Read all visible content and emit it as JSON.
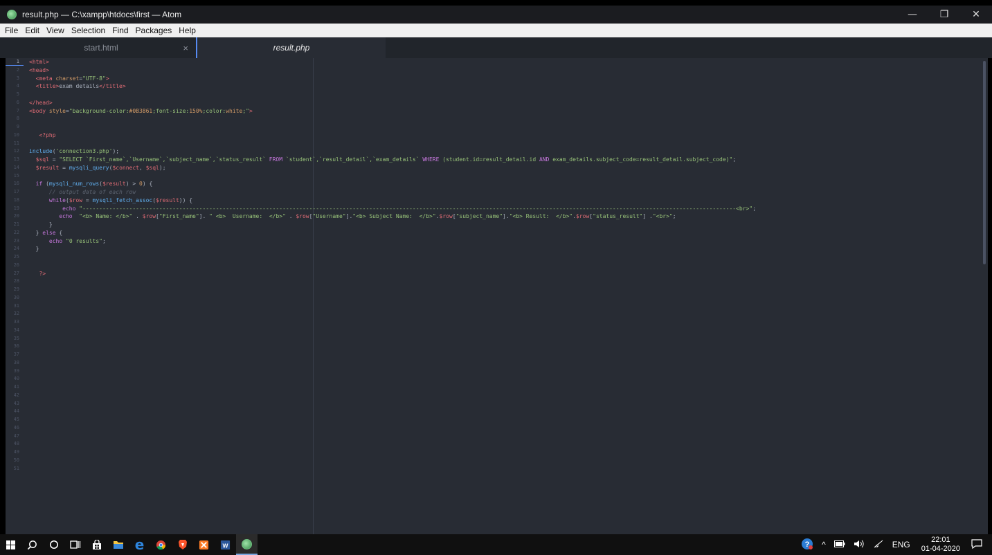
{
  "window": {
    "title": "result.php — C:\\xampp\\htdocs\\first — Atom",
    "controls": [
      "—",
      "❐",
      "✕"
    ]
  },
  "menu": [
    "File",
    "Edit",
    "View",
    "Selection",
    "Find",
    "Packages",
    "Help"
  ],
  "tabs": [
    {
      "label": "start.html",
      "active": false,
      "close": "×"
    },
    {
      "label": "result.php",
      "active": true
    }
  ],
  "editor": {
    "line_count": 51,
    "current_line": 1,
    "lines": [
      [
        [
          "t-tag",
          "<html>"
        ]
      ],
      [
        [
          "t-tag",
          "<head>"
        ]
      ],
      [
        [
          "t-def",
          "  "
        ],
        [
          "t-tag",
          "<meta "
        ],
        [
          "t-attr",
          "charset"
        ],
        [
          "t-def",
          "="
        ],
        [
          "t-str",
          "\"UTF-8\""
        ],
        [
          "t-tag",
          ">"
        ]
      ],
      [
        [
          "t-def",
          "  "
        ],
        [
          "t-tag",
          "<title>"
        ],
        [
          "t-def",
          "exam details"
        ],
        [
          "t-tag",
          "</title>"
        ]
      ],
      [],
      [
        [
          "t-tag",
          "</head>"
        ]
      ],
      [
        [
          "t-tag",
          "<body "
        ],
        [
          "t-attr",
          "style"
        ],
        [
          "t-def",
          "="
        ],
        [
          "t-str",
          "\"background-color:"
        ],
        [
          "t-num",
          "#0B3861"
        ],
        [
          "t-str",
          ";font-size:"
        ],
        [
          "t-num",
          "150%"
        ],
        [
          "t-str",
          ";color:"
        ],
        [
          "t-attr",
          "white"
        ],
        [
          "t-str",
          ";\""
        ],
        [
          "t-tag",
          ">"
        ]
      ],
      [],
      [],
      [
        [
          "t-def",
          "   "
        ],
        [
          "t-tag",
          "<?php"
        ]
      ],
      [],
      [
        [
          "t-fn",
          "include"
        ],
        [
          "t-def",
          "("
        ],
        [
          "t-str",
          "'connection3.php'"
        ],
        [
          "t-def",
          ");"
        ]
      ],
      [
        [
          "t-def",
          "  "
        ],
        [
          "t-var",
          "$sql"
        ],
        [
          "t-def",
          " = "
        ],
        [
          "t-str",
          "\"SELECT `First_name`,`Username`,`subject_name`,`status_result` "
        ],
        [
          "t-kw",
          "FROM"
        ],
        [
          "t-str",
          " `student`,`result_detail`,`exam_details` "
        ],
        [
          "t-kw",
          "WHERE"
        ],
        [
          "t-str",
          " (student.id=result_detail.id "
        ],
        [
          "t-kw",
          "AND"
        ],
        [
          "t-str",
          " exam_details.subject_code=result_detail.subject_code)\""
        ],
        [
          "t-def",
          ";"
        ]
      ],
      [
        [
          "t-def",
          "  "
        ],
        [
          "t-var",
          "$result"
        ],
        [
          "t-def",
          " = "
        ],
        [
          "t-fn",
          "mysqli_query"
        ],
        [
          "t-def",
          "("
        ],
        [
          "t-var",
          "$connect"
        ],
        [
          "t-def",
          ", "
        ],
        [
          "t-var",
          "$sql"
        ],
        [
          "t-def",
          ");"
        ]
      ],
      [],
      [
        [
          "t-def",
          "  "
        ],
        [
          "t-kw",
          "if"
        ],
        [
          "t-def",
          " ("
        ],
        [
          "t-fn",
          "mysqli_num_rows"
        ],
        [
          "t-def",
          "("
        ],
        [
          "t-var",
          "$result"
        ],
        [
          "t-def",
          ") > "
        ],
        [
          "t-num",
          "0"
        ],
        [
          "t-def",
          ") {"
        ]
      ],
      [
        [
          "t-def",
          "      "
        ],
        [
          "t-com",
          "// output data of each row"
        ]
      ],
      [
        [
          "t-def",
          "      "
        ],
        [
          "t-kw",
          "while"
        ],
        [
          "t-def",
          "("
        ],
        [
          "t-var",
          "$row"
        ],
        [
          "t-def",
          " = "
        ],
        [
          "t-fn",
          "mysqli_fetch_assoc"
        ],
        [
          "t-def",
          "("
        ],
        [
          "t-var",
          "$result"
        ],
        [
          "t-def",
          ")) {"
        ]
      ],
      [
        [
          "t-def",
          "          "
        ],
        [
          "t-kw",
          "echo"
        ],
        [
          "t-def",
          " "
        ],
        [
          "t-str",
          "\"----------------------------------------------------------------------------------------------------------------------------------------------------------------------------------------------------<br>\""
        ],
        [
          "t-def",
          ";"
        ]
      ],
      [
        [
          "t-def",
          "         "
        ],
        [
          "t-kw",
          "echo"
        ],
        [
          "t-def",
          "  "
        ],
        [
          "t-str",
          "\"<b> Name: </b>\""
        ],
        [
          "t-def",
          " . "
        ],
        [
          "t-var",
          "$row"
        ],
        [
          "t-def",
          "["
        ],
        [
          "t-str",
          "\"First_name\""
        ],
        [
          "t-def",
          "]. "
        ],
        [
          "t-str",
          "\" <b>  Username:  </b>\""
        ],
        [
          "t-def",
          " . "
        ],
        [
          "t-var",
          "$row"
        ],
        [
          "t-def",
          "["
        ],
        [
          "t-str",
          "\"Username\""
        ],
        [
          "t-def",
          "]."
        ],
        [
          "t-str",
          "\"<b> Subject Name:  </b>\""
        ],
        [
          "t-def",
          "."
        ],
        [
          "t-var",
          "$row"
        ],
        [
          "t-def",
          "["
        ],
        [
          "t-str",
          "\"subject_name\""
        ],
        [
          "t-def",
          "]."
        ],
        [
          "t-str",
          "\"<b> Result:  </b>\""
        ],
        [
          "t-def",
          "."
        ],
        [
          "t-var",
          "$row"
        ],
        [
          "t-def",
          "["
        ],
        [
          "t-str",
          "\"status_result\""
        ],
        [
          "t-def",
          "] ."
        ],
        [
          "t-str",
          "\"<br>\""
        ],
        [
          "t-def",
          ";"
        ]
      ],
      [
        [
          "t-def",
          "      }"
        ]
      ],
      [
        [
          "t-def",
          "  } "
        ],
        [
          "t-kw",
          "else"
        ],
        [
          "t-def",
          " {"
        ]
      ],
      [
        [
          "t-def",
          "      "
        ],
        [
          "t-kw",
          "echo"
        ],
        [
          "t-def",
          " "
        ],
        [
          "t-str",
          "\"0 results\""
        ],
        [
          "t-def",
          ";"
        ]
      ],
      [
        [
          "t-def",
          "  }"
        ]
      ],
      [],
      [],
      [
        [
          "t-def",
          "   "
        ],
        [
          "t-tag",
          "?>"
        ]
      ]
    ]
  },
  "taskbar": {
    "icons": [
      "windows-start-icon",
      "search-icon",
      "cortana-icon",
      "task-view-icon",
      "store-icon",
      "file-explorer-icon",
      "edge-icon",
      "chrome-icon",
      "brave-icon",
      "xampp-icon",
      "word-icon",
      "atom-icon"
    ],
    "tray": {
      "chevron": "^",
      "language": "ENG",
      "time": "22:01",
      "date": "01-04-2020"
    }
  }
}
